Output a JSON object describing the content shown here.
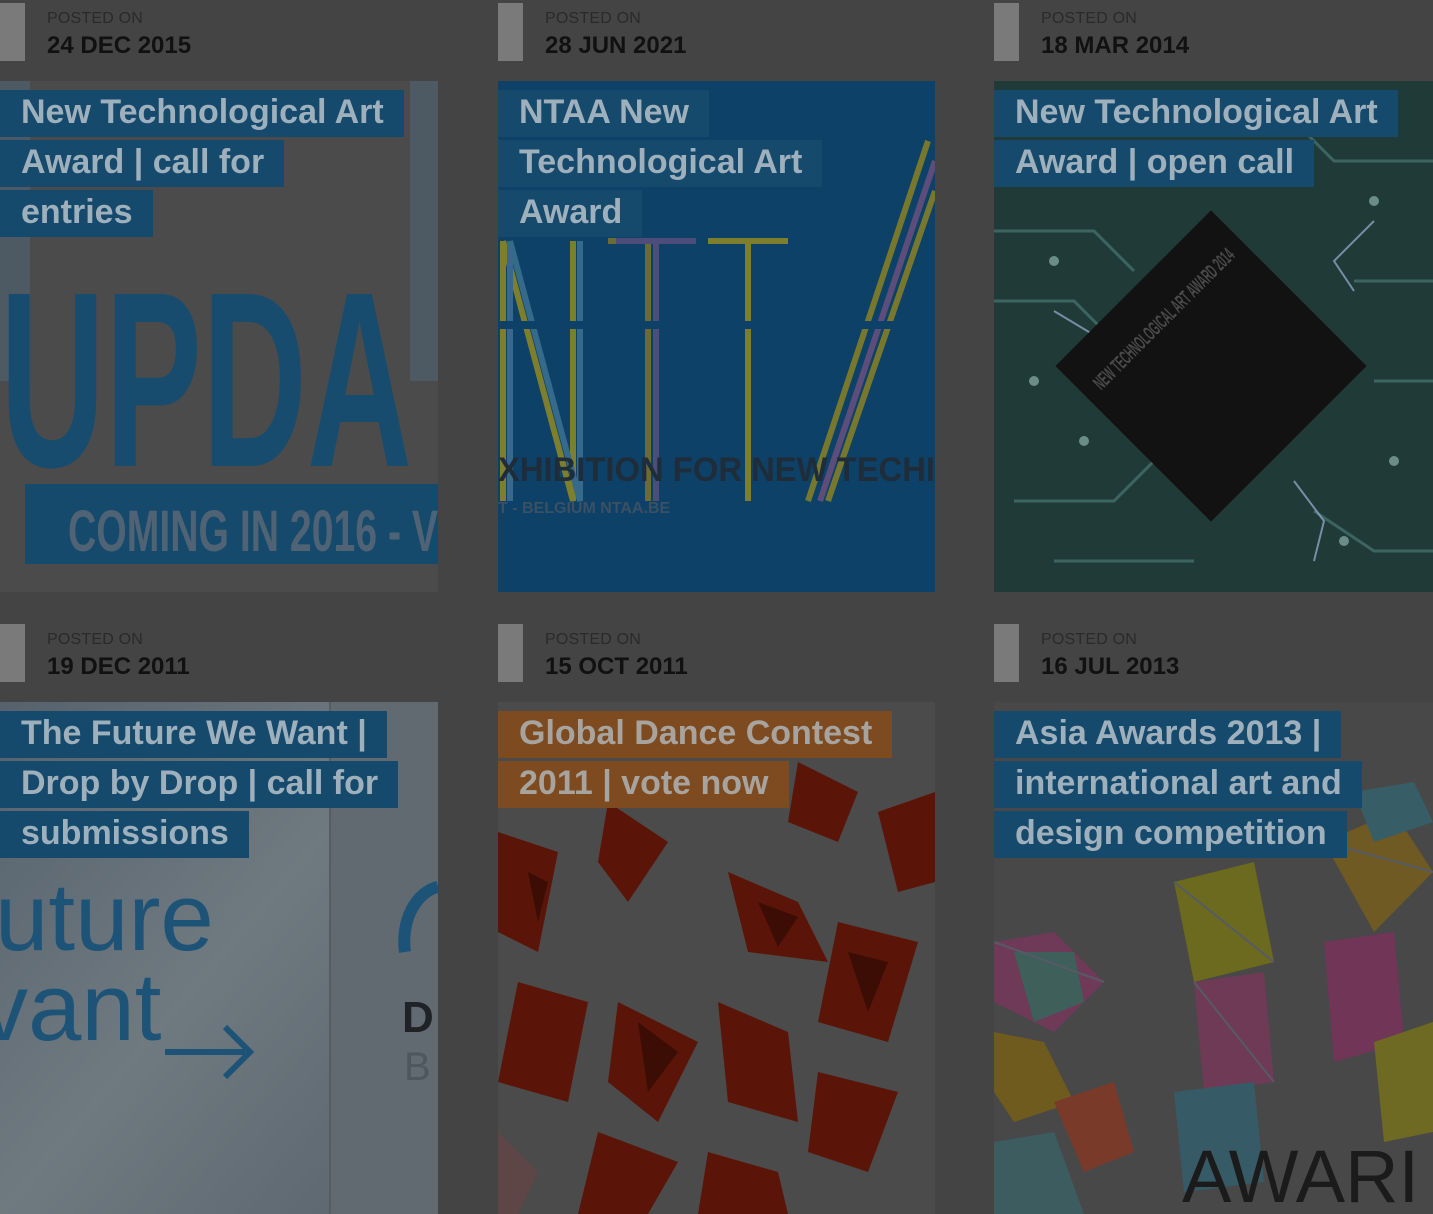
{
  "posted_label": "POSTED ON",
  "colors": {
    "overlay_bg": "#444444",
    "title_bg": "#164a6c",
    "title_bg_alt": "#7e4a1f",
    "title_text": "#9fb0bd"
  },
  "posts": [
    {
      "date": "24 DEC 2015",
      "title": "New Technological Art Award | call for entries",
      "image": {
        "big_text": "UPDA",
        "band_text": "COMING IN 2016 - V"
      }
    },
    {
      "date": "28 JUN 2021",
      "title": "NTAA New Technological Art Award",
      "image": {
        "big_text": "NTA",
        "band_text": "XHIBITION FOR NEW TECHI",
        "sub_text": "T - BELGIUM   NTAA.BE"
      }
    },
    {
      "date": "18 MAR 2014",
      "title": "New Technological Art Award | open call",
      "image": {
        "chip_text": "NEW TECHNOLOGICAL ART AWARD 2014"
      }
    },
    {
      "date": "19 DEC 2011",
      "title": "The Future We Want | Drop by Drop | call for submissions",
      "image": {
        "line1": "uture",
        "line2": "vant",
        "side_letter": "D",
        "side_letter2": "B"
      }
    },
    {
      "date": "15 OCT 2011",
      "title": "Global Dance Contest 2011 | vote now",
      "image": {}
    },
    {
      "date": "16 JUL 2013",
      "title": "Asia Awards 2013 | international art and design competition",
      "image": {
        "bottom_text": "AWARI"
      }
    }
  ]
}
